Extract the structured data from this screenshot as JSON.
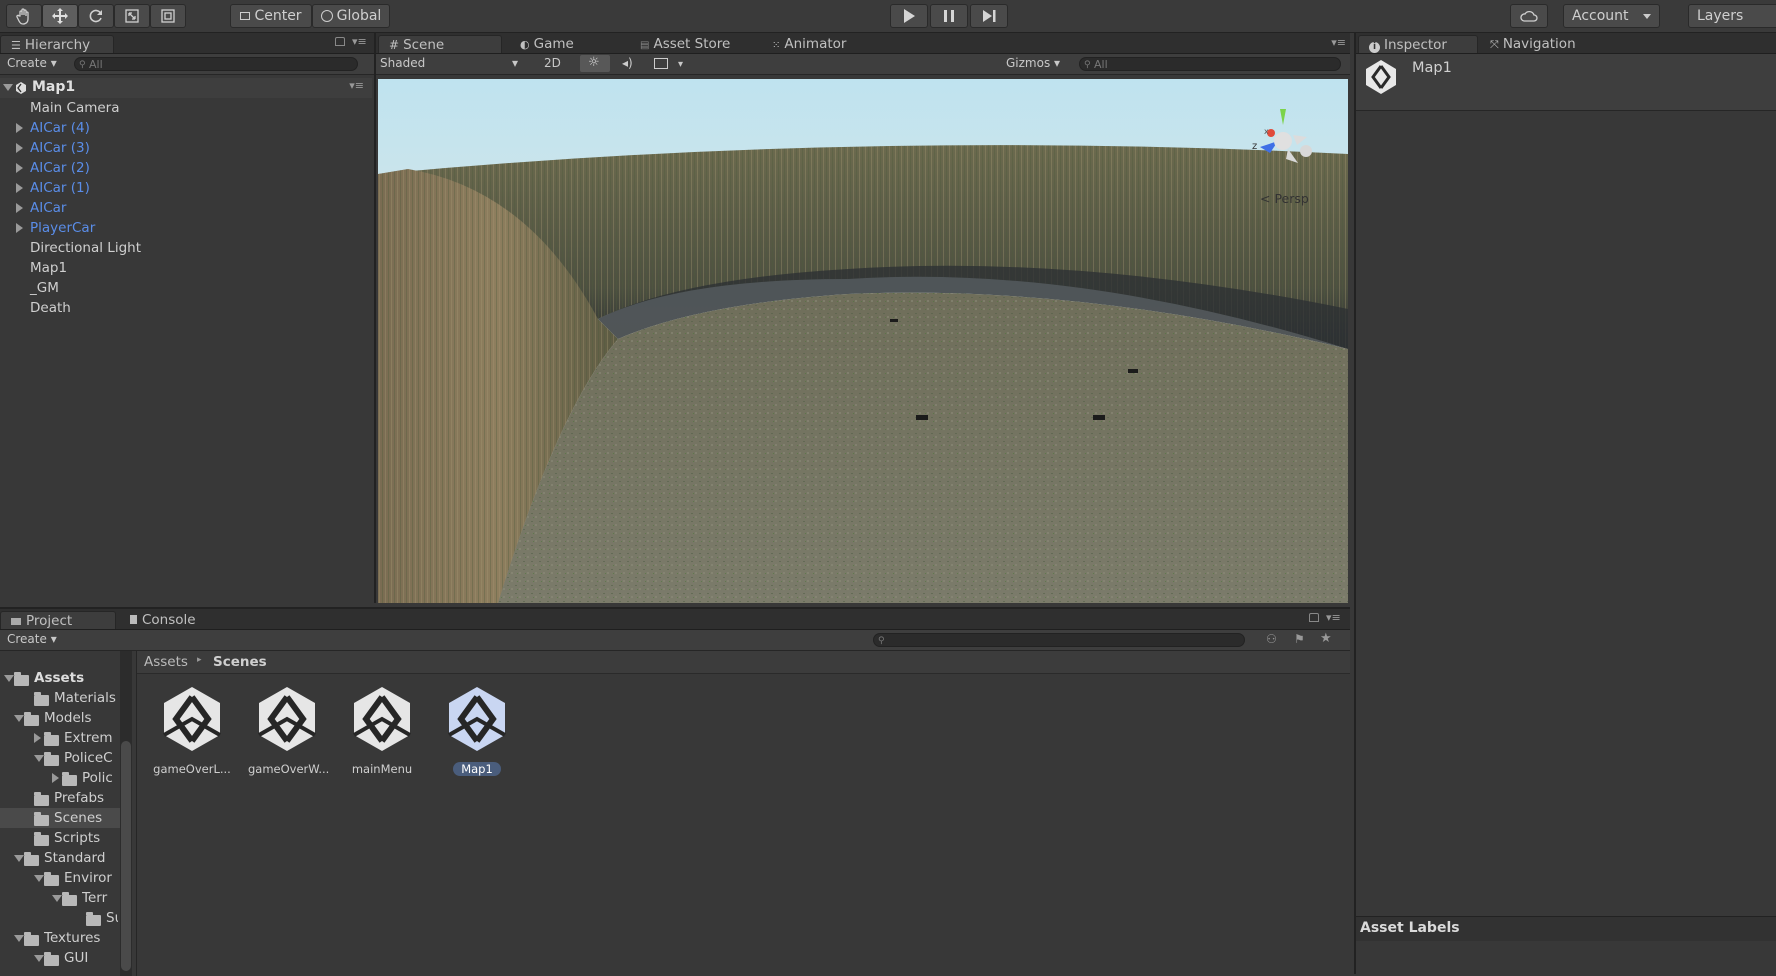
{
  "toolbar": {
    "pivot_label": "Center",
    "space_label": "Global",
    "account_label": "Account",
    "layers_label": "Layers",
    "icons": [
      "hand-icon",
      "move-icon",
      "rotate-icon",
      "scale-icon",
      "rect-icon",
      "play-icon",
      "pause-icon",
      "step-icon",
      "cloud-icon"
    ]
  },
  "hierarchy": {
    "tab": "Hierarchy",
    "create": "Create",
    "search_placeholder": "All",
    "scene": "Map1",
    "items": [
      {
        "label": "Main Camera",
        "prefab": false,
        "expandable": false
      },
      {
        "label": "AICar (4)",
        "prefab": true,
        "expandable": true
      },
      {
        "label": "AICar (3)",
        "prefab": true,
        "expandable": true
      },
      {
        "label": "AICar (2)",
        "prefab": true,
        "expandable": true
      },
      {
        "label": "AICar (1)",
        "prefab": true,
        "expandable": true
      },
      {
        "label": "AICar",
        "prefab": true,
        "expandable": true
      },
      {
        "label": "PlayerCar",
        "prefab": true,
        "expandable": true
      },
      {
        "label": "Directional Light",
        "prefab": false,
        "expandable": false
      },
      {
        "label": "Map1",
        "prefab": false,
        "expandable": false
      },
      {
        "label": "_GM",
        "prefab": false,
        "expandable": false
      },
      {
        "label": "Death",
        "prefab": false,
        "expandable": false
      }
    ]
  },
  "scene_view": {
    "tabs": [
      "Scene",
      "Game",
      "Asset Store",
      "Animator"
    ],
    "shading": "Shaded",
    "mode_2d": "2D",
    "gizmos": "Gizmos",
    "search_placeholder": "All",
    "projection": "Persp",
    "axis_z": "z",
    "axis_x": "x"
  },
  "inspector": {
    "tabs": [
      "Inspector",
      "Navigation"
    ],
    "object_name": "Map1",
    "asset_labels": "Asset Labels"
  },
  "project": {
    "tabs": [
      "Project",
      "Console"
    ],
    "create": "Create",
    "breadcrumb": [
      "Assets",
      "Scenes"
    ],
    "tree": [
      {
        "label": "Assets",
        "bold": true
      },
      {
        "label": "Materials"
      },
      {
        "label": "Models"
      },
      {
        "label": "Extrem"
      },
      {
        "label": "PoliceC"
      },
      {
        "label": "Polic"
      },
      {
        "label": "Prefabs"
      },
      {
        "label": "Scenes"
      },
      {
        "label": "Scripts"
      },
      {
        "label": "Standard"
      },
      {
        "label": "Enviror"
      },
      {
        "label": "Terr"
      },
      {
        "label": "Su"
      },
      {
        "label": "Textures"
      },
      {
        "label": "GUI"
      }
    ],
    "assets": [
      {
        "label": "gameOverL...",
        "selected": false
      },
      {
        "label": "gameOverW...",
        "selected": false
      },
      {
        "label": "mainMenu",
        "selected": false
      },
      {
        "label": "Map1",
        "selected": true
      }
    ]
  }
}
